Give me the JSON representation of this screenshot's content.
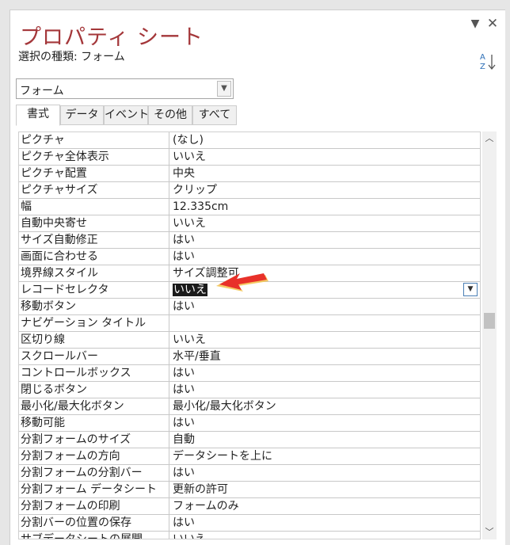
{
  "pane": {
    "title": "プロパティ シート",
    "dropdown_icon": "triangle-down-icon",
    "close_icon": "close-icon",
    "selection_type_label": "選択の種類: フォーム",
    "sort_icon": "sort-az-icon"
  },
  "object_selector": {
    "value": "フォーム"
  },
  "tabs": [
    {
      "label": "書式",
      "active": true
    },
    {
      "label": "データ",
      "active": false
    },
    {
      "label": "イベント",
      "active": false
    },
    {
      "label": "その他",
      "active": false
    },
    {
      "label": "すべて",
      "active": false
    }
  ],
  "properties": [
    {
      "name": "ピクチャ",
      "value": "(なし)"
    },
    {
      "name": "ピクチャ全体表示",
      "value": "いいえ"
    },
    {
      "name": "ピクチャ配置",
      "value": "中央"
    },
    {
      "name": "ピクチャサイズ",
      "value": "クリップ"
    },
    {
      "name": "幅",
      "value": "12.335cm"
    },
    {
      "name": "自動中央寄せ",
      "value": "いいえ"
    },
    {
      "name": "サイズ自動修正",
      "value": "はい"
    },
    {
      "name": "画面に合わせる",
      "value": "はい"
    },
    {
      "name": "境界線スタイル",
      "value": "サイズ調整可"
    },
    {
      "name": "レコードセレクタ",
      "value": "いいえ"
    },
    {
      "name": "移動ボタン",
      "value": "はい"
    },
    {
      "name": "ナビゲーション タイトル",
      "value": ""
    },
    {
      "name": "区切り線",
      "value": "いいえ"
    },
    {
      "name": "スクロールバー",
      "value": "水平/垂直"
    },
    {
      "name": "コントロールボックス",
      "value": "はい"
    },
    {
      "name": "閉じるボタン",
      "value": "はい"
    },
    {
      "name": "最小化/最大化ボタン",
      "value": "最小化/最大化ボタン"
    },
    {
      "name": "移動可能",
      "value": "はい"
    },
    {
      "name": "分割フォームのサイズ",
      "value": "自動"
    },
    {
      "name": "分割フォームの方向",
      "value": "データシートを上に"
    },
    {
      "name": "分割フォームの分割バー",
      "value": "はい"
    },
    {
      "name": "分割フォーム データシート",
      "value": "更新の許可"
    },
    {
      "name": "分割フォームの印刷",
      "value": "フォームのみ"
    },
    {
      "name": "分割バーの位置の保存",
      "value": "はい"
    },
    {
      "name": "サブデータシートの展開",
      "value": "いいえ"
    }
  ],
  "selected_property_index": 9,
  "pointer_icon": "arrow-pointer-icon",
  "colors": {
    "title": "#a4373a",
    "pointer": "#e8312a",
    "pointer_shadow": "#f3c24a"
  }
}
